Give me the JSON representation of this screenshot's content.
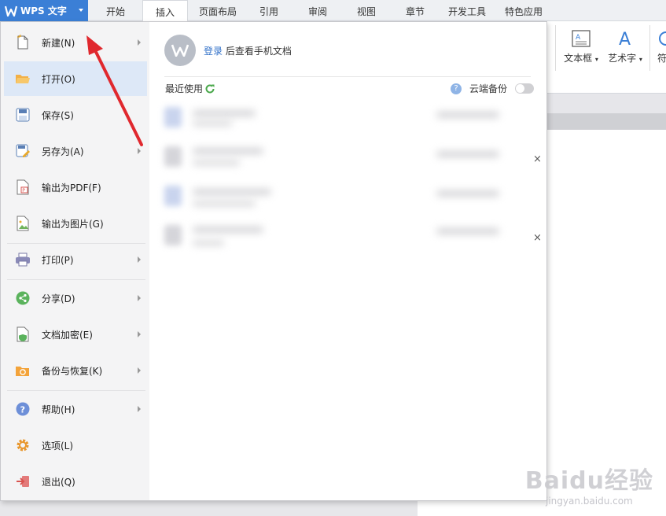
{
  "topbar": {
    "app_button": "WPS 文字",
    "tabs": [
      "开始",
      "插入",
      "页面布局",
      "引用",
      "审阅",
      "视图",
      "章节",
      "开发工具",
      "特色应用"
    ],
    "active_tab": "插入"
  },
  "ribbon": {
    "textbox_label": "文本框",
    "wordart_label": "艺术字",
    "symbol_label": "符"
  },
  "menu": {
    "items": [
      {
        "label": "新建(N)",
        "has_submenu": true
      },
      {
        "label": "打开(O)",
        "has_submenu": false
      },
      {
        "label": "保存(S)",
        "has_submenu": false
      },
      {
        "label": "另存为(A)",
        "has_submenu": true
      },
      {
        "label": "输出为PDF(F)",
        "has_submenu": false
      },
      {
        "label": "输出为图片(G)",
        "has_submenu": false
      },
      {
        "label": "打印(P)",
        "has_submenu": true
      },
      {
        "label": "分享(D)",
        "has_submenu": true
      },
      {
        "label": "文档加密(E)",
        "has_submenu": true
      },
      {
        "label": "备份与恢复(K)",
        "has_submenu": true
      },
      {
        "label": "帮助(H)",
        "has_submenu": true
      },
      {
        "label": "选项(L)",
        "has_submenu": false
      },
      {
        "label": "退出(Q)",
        "has_submenu": false
      }
    ],
    "hovered": "打开(O)"
  },
  "account": {
    "login_link": "登录",
    "login_suffix": " 后查看手机文档"
  },
  "recent": {
    "label": "最近使用",
    "cloud_backup_label": "云端备份",
    "cloud_backup_enabled": false,
    "close_glyph": "×"
  },
  "watermark": {
    "brand": "Baidu经验",
    "url": "jingyan.baidu.com"
  },
  "colors": {
    "accent": "#3b7fd6",
    "hover": "#dde8f7",
    "annotation": "#e0282e",
    "link": "#2f6fc8"
  }
}
